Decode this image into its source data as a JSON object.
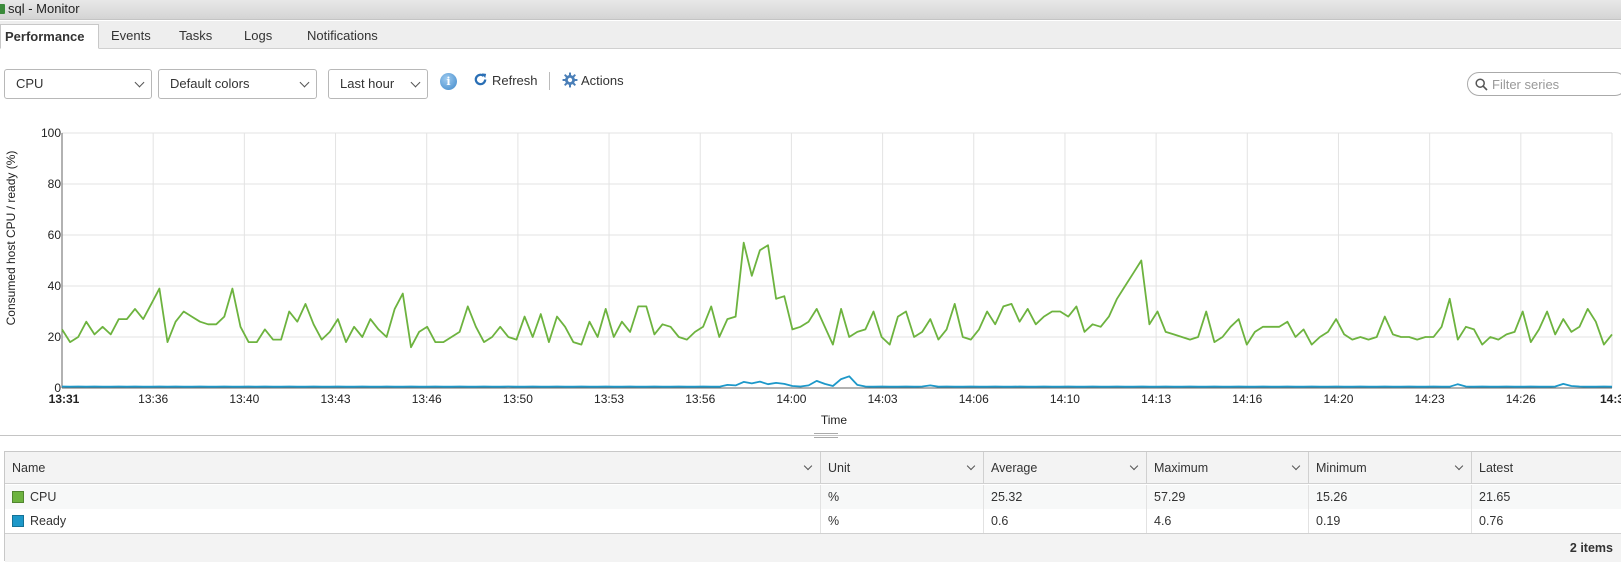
{
  "window": {
    "title": "sql - Monitor"
  },
  "tabs": [
    {
      "label": "Performance",
      "active": true
    },
    {
      "label": "Events"
    },
    {
      "label": "Tasks"
    },
    {
      "label": "Logs"
    },
    {
      "label": "Notifications"
    }
  ],
  "toolbar": {
    "metric_select": "CPU",
    "color_select": "Default colors",
    "time_select": "Last hour",
    "refresh_label": "Refresh",
    "actions_label": "Actions",
    "filter_placeholder": "Filter series"
  },
  "chart_data": {
    "type": "line",
    "ylabel": "Consumed host CPU / ready (%)",
    "xlabel": "Time",
    "ylim": [
      0,
      100
    ],
    "yticks": [
      0,
      20,
      40,
      60,
      80,
      100
    ],
    "x_tick_labels": [
      "13:31",
      "13:36",
      "13:40",
      "13:43",
      "13:46",
      "13:50",
      "13:53",
      "13:56",
      "14:00",
      "14:03",
      "14:06",
      "14:10",
      "14:13",
      "14:16",
      "14:20",
      "14:23",
      "14:26",
      "14:3"
    ],
    "grid": true,
    "series": [
      {
        "name": "CPU",
        "color": "#6db33f",
        "values": [
          23,
          18,
          20,
          26,
          21,
          24,
          21,
          27,
          27,
          31,
          27,
          33,
          39,
          18,
          26,
          30,
          28,
          26,
          25,
          25,
          28,
          39,
          24,
          18,
          18,
          23,
          19,
          19,
          30,
          26,
          33,
          25,
          19,
          22,
          27,
          18,
          24,
          20,
          27,
          23,
          20,
          31,
          37,
          16,
          22,
          24,
          18,
          18,
          20,
          22,
          32,
          24,
          18,
          20,
          24,
          20,
          19,
          28,
          20,
          29,
          18,
          28,
          24,
          18,
          17,
          26,
          20,
          31,
          20,
          26,
          22,
          32,
          32,
          21,
          25,
          24,
          20,
          19,
          22,
          24,
          32,
          20,
          27,
          28,
          57,
          44,
          54,
          56,
          35,
          36,
          23,
          24,
          26,
          31,
          24,
          17,
          31,
          20,
          22,
          23,
          30,
          20,
          17,
          28,
          30,
          20,
          22,
          27,
          19,
          23,
          33,
          20,
          19,
          23,
          30,
          25,
          32,
          33,
          26,
          31,
          25,
          28,
          30,
          30,
          28,
          32,
          22,
          25,
          24,
          28,
          35,
          40,
          45,
          50,
          25,
          30,
          22,
          21,
          20,
          19,
          20,
          30,
          18,
          20,
          24,
          27,
          17,
          22,
          24,
          24,
          24,
          26,
          20,
          23,
          17,
          20,
          22,
          27,
          21,
          19,
          20,
          19,
          20,
          28,
          21,
          20,
          20,
          19,
          20,
          20,
          24,
          35,
          19,
          24,
          23,
          17,
          20,
          19,
          21,
          22,
          30,
          18,
          23,
          30,
          21,
          27,
          22,
          24,
          31,
          26,
          17,
          21
        ]
      },
      {
        "name": "Ready",
        "color": "#1d98c9",
        "values": [
          0.6,
          0.5,
          0.6,
          0.5,
          0.6,
          0.5,
          0.5,
          0.6,
          0.5,
          0.6,
          0.5,
          0.5,
          0.6,
          0.5,
          0.6,
          0.5,
          0.5,
          0.6,
          0.5,
          0.5,
          0.6,
          0.5,
          0.5,
          0.6,
          0.5,
          0.6,
          0.5,
          0.5,
          0.6,
          0.5,
          0.5,
          0.6,
          0.5,
          0.5,
          0.6,
          0.5,
          0.5,
          0.6,
          0.5,
          0.5,
          0.6,
          0.5,
          0.5,
          0.6,
          0.5,
          0.5,
          0.6,
          0.5,
          0.5,
          0.6,
          0.5,
          0.5,
          0.6,
          0.5,
          0.5,
          0.6,
          0.5,
          0.5,
          0.6,
          0.5,
          0.5,
          0.6,
          0.5,
          0.5,
          0.6,
          0.5,
          0.5,
          0.6,
          0.5,
          0.5,
          0.6,
          0.5,
          0.5,
          0.6,
          0.5,
          0.5,
          0.6,
          0.5,
          0.5,
          0.6,
          0.5,
          0.5,
          1.2,
          1,
          2.4,
          1.8,
          2.5,
          1.5,
          2,
          1.6,
          0.8,
          0.6,
          1,
          2.8,
          1.6,
          0.8,
          3.5,
          4.6,
          1.2,
          0.6,
          0.5,
          0.6,
          0.5,
          0.5,
          0.6,
          0.5,
          0.6,
          1,
          0.5,
          0.6,
          0.5,
          0.5,
          0.6,
          0.5,
          0.5,
          0.6,
          0.5,
          0.5,
          0.6,
          0.5,
          0.5,
          0.6,
          0.5,
          0.5,
          0.6,
          0.5,
          0.5,
          0.6,
          0.5,
          0.5,
          0.6,
          0.5,
          0.5,
          0.6,
          0.5,
          0.5,
          0.6,
          0.5,
          0.5,
          0.6,
          0.5,
          0.5,
          0.6,
          0.5,
          0.5,
          0.6,
          0.5,
          0.5,
          0.6,
          0.5,
          0.5,
          0.6,
          0.5,
          0.5,
          0.6,
          0.5,
          0.5,
          0.6,
          0.5,
          0.5,
          0.6,
          0.5,
          0.5,
          0.6,
          0.5,
          0.5,
          0.6,
          0.5,
          0.5,
          0.6,
          0.5,
          0.5,
          1.5,
          0.6,
          0.5,
          0.6,
          0.5,
          0.5,
          0.6,
          0.5,
          0.5,
          0.6,
          0.5,
          0.5,
          0.6,
          1.6,
          0.8,
          0.6,
          0.5,
          0.5,
          0.6,
          0.5
        ]
      }
    ]
  },
  "table": {
    "columns": [
      "Name",
      "Unit",
      "Average",
      "Maximum",
      "Minimum",
      "Latest"
    ],
    "rows": [
      {
        "color": "#6db33f",
        "cells": [
          "CPU",
          "%",
          "25.32",
          "57.29",
          "15.26",
          "21.65"
        ]
      },
      {
        "color": "#1d98c9",
        "cells": [
          "Ready",
          "%",
          "0.6",
          "4.6",
          "0.19",
          "0.76"
        ]
      }
    ],
    "footer": "2 items"
  }
}
